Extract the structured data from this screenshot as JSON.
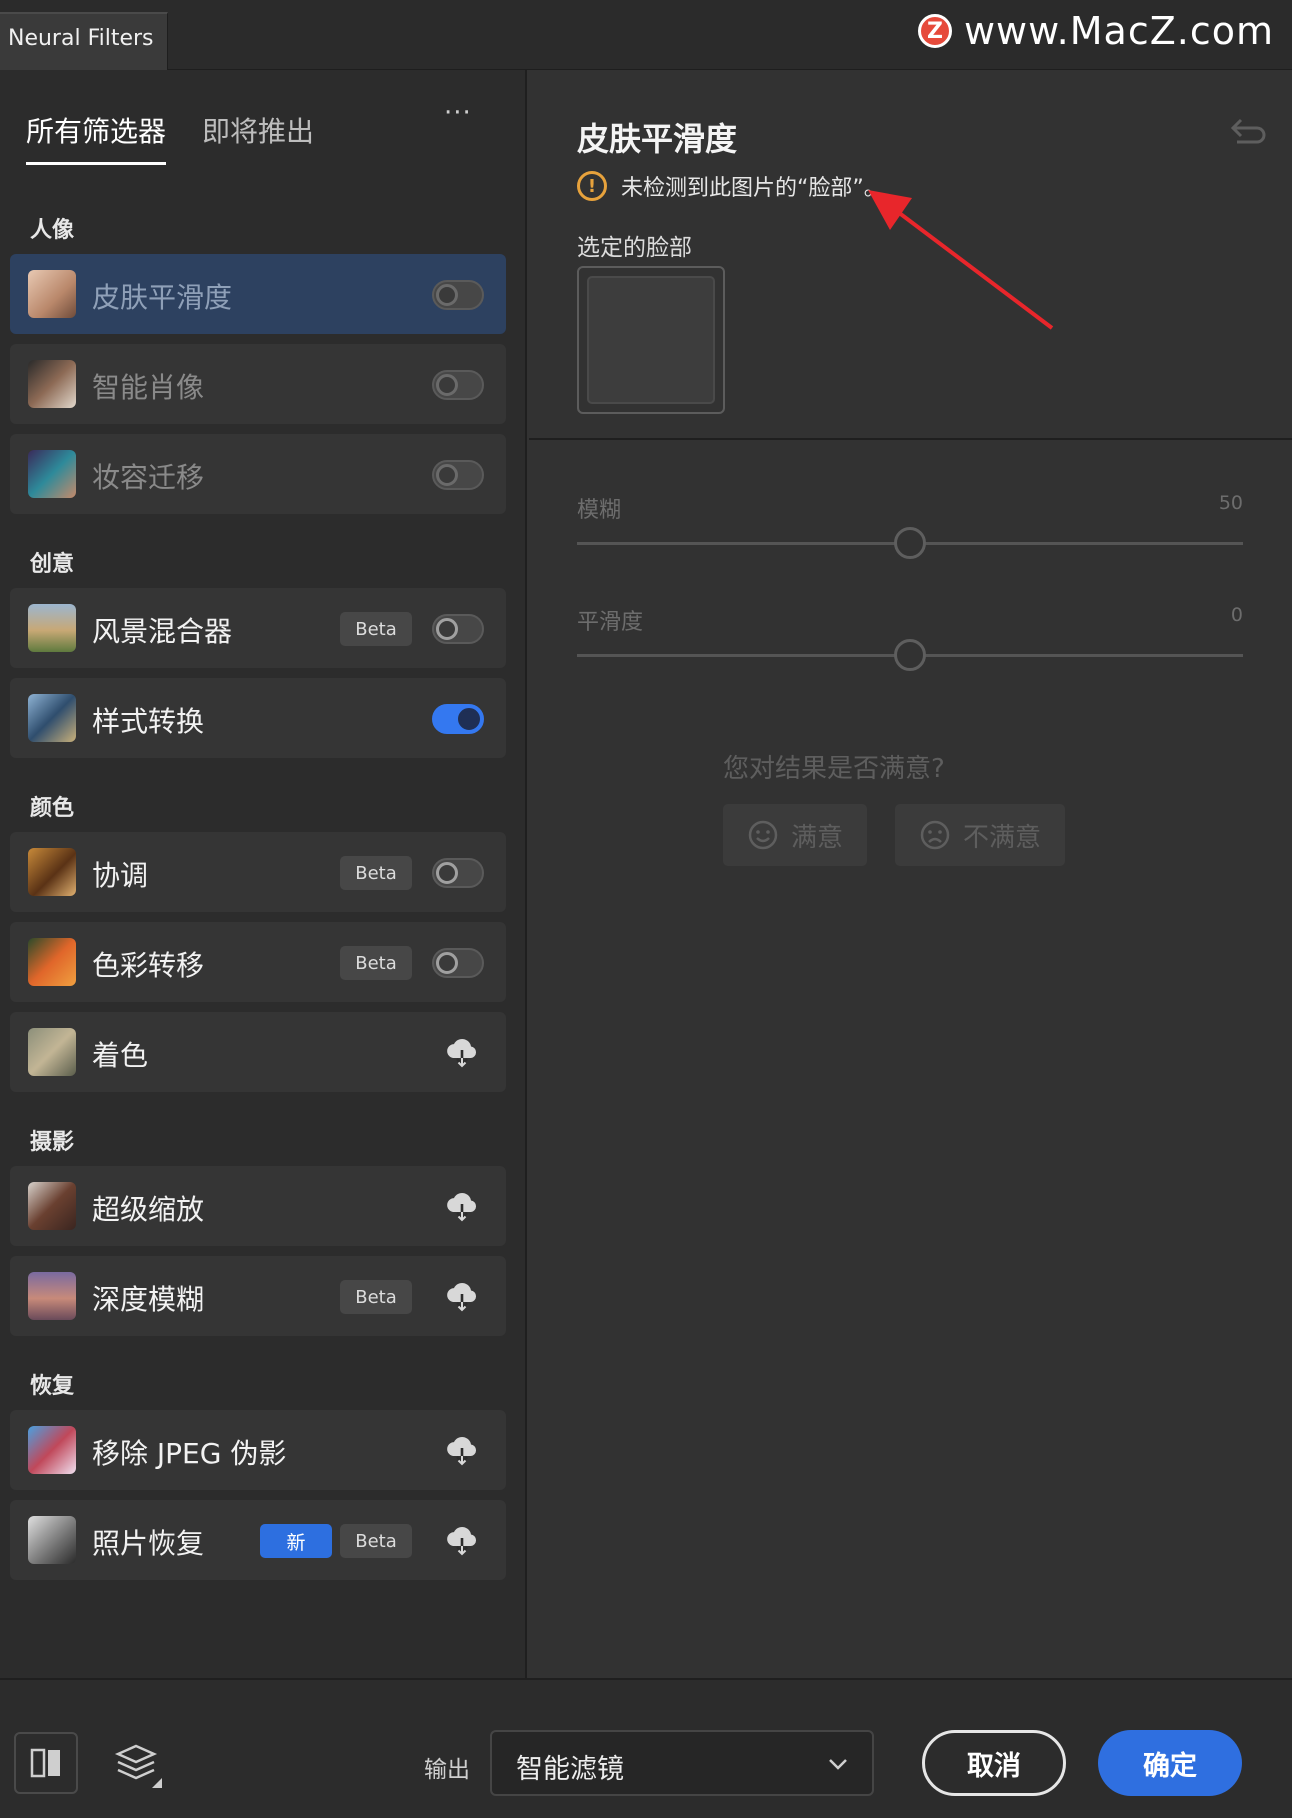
{
  "window": {
    "doc_tab": "Neural Filters",
    "watermark_logo": "Z",
    "watermark_text": "www.MacZ.com"
  },
  "filter_tabs": [
    {
      "label": "所有筛选器",
      "active": true
    },
    {
      "label": "即将推出",
      "active": false
    }
  ],
  "more_label": "···",
  "sections": {
    "portrait": "人像",
    "creative": "创意",
    "color": "颜色",
    "photo": "摄影",
    "restore": "恢复"
  },
  "filters": [
    {
      "label": "皮肤平滑度",
      "control": "toggle",
      "on": false,
      "state": "selected"
    },
    {
      "label": "智能肖像",
      "control": "toggle",
      "on": false,
      "state": "dim"
    },
    {
      "label": "妆容迁移",
      "control": "toggle",
      "on": false,
      "state": "dim"
    },
    {
      "label": "风景混合器",
      "badge": "Beta",
      "control": "toggle",
      "on": false
    },
    {
      "label": "样式转换",
      "control": "toggle",
      "on": true
    },
    {
      "label": "协调",
      "badge": "Beta",
      "control": "toggle",
      "on": false
    },
    {
      "label": "色彩转移",
      "badge": "Beta",
      "control": "toggle",
      "on": false
    },
    {
      "label": "着色",
      "control": "download"
    },
    {
      "label": "超级缩放",
      "control": "download"
    },
    {
      "label": "深度模糊",
      "badge": "Beta",
      "control": "download"
    },
    {
      "label": "移除 JPEG 伪影",
      "control": "download"
    },
    {
      "label": "照片恢复",
      "new_badge": "新",
      "badge": "Beta",
      "control": "download"
    }
  ],
  "detail": {
    "title": "皮肤平滑度",
    "warning": "未检测到此图片的“脸部”。",
    "selected_face_label": "选定的脸部",
    "sliders": [
      {
        "label": "模糊",
        "value": "50",
        "position": 0.5
      },
      {
        "label": "平滑度",
        "value": "0",
        "position": 0.5
      }
    ],
    "feedback_question": "您对结果是否满意?",
    "satisfied": "满意",
    "unsatisfied": "不满意"
  },
  "footer": {
    "output_label": "输出",
    "output_value": "智能滤镜",
    "cancel": "取消",
    "ok": "确定"
  },
  "colors": {
    "accent": "#2f6fe0",
    "selected_row": "#2d4160",
    "warning": "#e7a23c",
    "annotation_arrow": "#e8262b"
  }
}
